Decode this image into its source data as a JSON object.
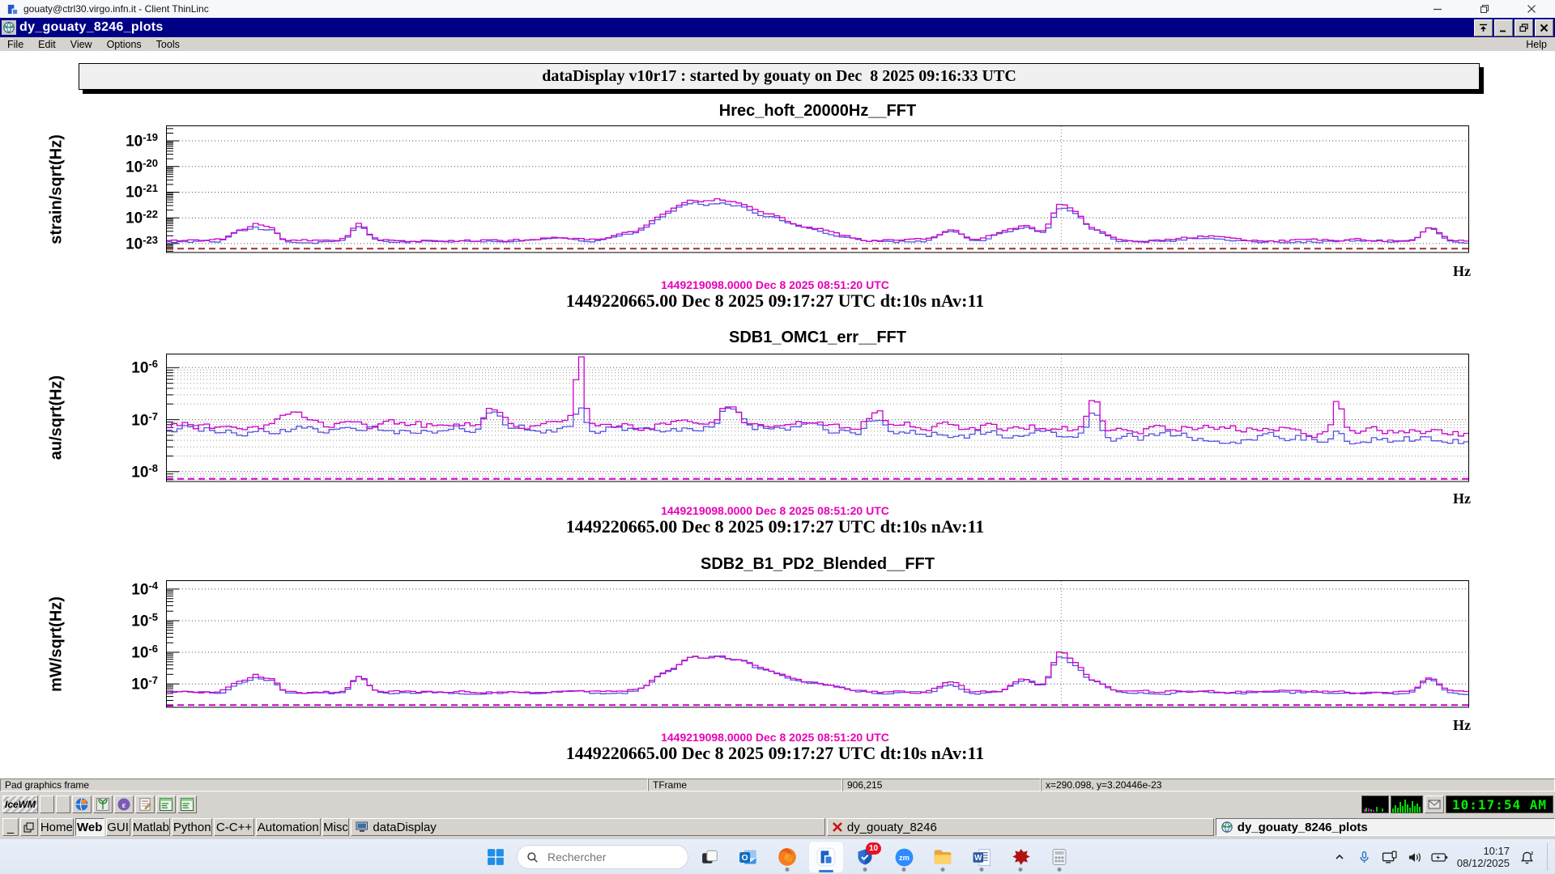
{
  "window": {
    "thinlinc_title": "gouaty@ctrl30.virgo.infn.it - Client ThinLinc",
    "app_title": "dy_gouaty_8246_plots",
    "menu_items": [
      "File",
      "Edit",
      "View",
      "Options",
      "Tools"
    ],
    "menu_help": "Help",
    "banner": "dataDisplay v10r17 : started by gouaty on Dec  8 2025 09:16:33 UTC"
  },
  "footer": {
    "gps_line": "1449219098.0000 Dec 8 2025 08:51:20 UTC",
    "utc_line": "1449220665.00 Dec 8 2025 09:17:27 UTC dt:10s nAv:11"
  },
  "chart_data": [
    {
      "type": "line",
      "title": "Hrec_hoft_20000Hz__FFT",
      "ylabel": "strain/sqrt(Hz)",
      "xlabel": "Hz",
      "yticks_exp": [
        -19,
        -20,
        -21,
        -22,
        -23
      ],
      "ylog_range": [
        -23.35,
        -18.4
      ],
      "minor_grid": false,
      "x_gridline_frac": 0.687,
      "ref_line": {
        "log": -23.2,
        "color": "#993333"
      },
      "series": [
        {
          "name": "blue spectrum",
          "color": "#5555e0",
          "seed": 77,
          "baseline": -22.92,
          "noise": 0.06,
          "peaks": [
            [
              0.054,
              0.38,
              0.006
            ],
            [
              0.067,
              0.55,
              0.005
            ],
            [
              0.079,
              0.46,
              0.005
            ],
            [
              0.147,
              0.6,
              0.006
            ],
            [
              0.3,
              0.14,
              0.012
            ],
            [
              0.355,
              0.28,
              0.015
            ],
            [
              0.385,
              0.92,
              0.012
            ],
            [
              0.404,
              1.1,
              0.009
            ],
            [
              0.422,
              1.16,
              0.009
            ],
            [
              0.44,
              1.0,
              0.01
            ],
            [
              0.462,
              0.8,
              0.014
            ],
            [
              0.495,
              0.42,
              0.02
            ],
            [
              0.603,
              0.4,
              0.008
            ],
            [
              0.641,
              0.25,
              0.008
            ],
            [
              0.66,
              0.5,
              0.009
            ],
            [
              0.687,
              1.22,
              0.0065
            ],
            [
              0.7,
              0.78,
              0.006
            ],
            [
              0.715,
              0.4,
              0.008
            ],
            [
              0.8,
              0.16,
              0.012
            ],
            [
              0.972,
              0.5,
              0.006
            ]
          ]
        },
        {
          "name": "magenta spectrum",
          "color": "#cc00cc",
          "seed": 913,
          "baseline": -22.88,
          "noise": 0.06,
          "peaks": [
            [
              0.054,
              0.4,
              0.006
            ],
            [
              0.067,
              0.58,
              0.005
            ],
            [
              0.079,
              0.48,
              0.005
            ],
            [
              0.147,
              0.62,
              0.006
            ],
            [
              0.3,
              0.15,
              0.012
            ],
            [
              0.355,
              0.3,
              0.015
            ],
            [
              0.385,
              0.95,
              0.012
            ],
            [
              0.404,
              1.15,
              0.009
            ],
            [
              0.422,
              1.22,
              0.009
            ],
            [
              0.44,
              1.05,
              0.01
            ],
            [
              0.462,
              0.85,
              0.014
            ],
            [
              0.495,
              0.45,
              0.02
            ],
            [
              0.603,
              0.42,
              0.008
            ],
            [
              0.641,
              0.26,
              0.008
            ],
            [
              0.66,
              0.52,
              0.009
            ],
            [
              0.687,
              1.35,
              0.0065
            ],
            [
              0.7,
              0.82,
              0.006
            ],
            [
              0.715,
              0.42,
              0.008
            ],
            [
              0.8,
              0.18,
              0.012
            ],
            [
              0.972,
              0.52,
              0.006
            ]
          ]
        }
      ]
    },
    {
      "type": "line",
      "title": "SDB1_OMC1_err__FFT",
      "ylabel": "au/sqrt(Hz)",
      "xlabel": "Hz",
      "yticks_exp": [
        -6,
        -7,
        -8
      ],
      "ylog_range": [
        -8.19,
        -5.73
      ],
      "minor_grid": true,
      "x_gridline_frac": 0.687,
      "ref_line": {
        "log": -8.14,
        "color": "#cc00cc"
      },
      "series": [
        {
          "name": "blue spectrum",
          "color": "#5555e0",
          "seed": 301,
          "baseline": -7.22,
          "noise": 0.1,
          "drift": [
            [
              0,
              0.02
            ],
            [
              0.45,
              0.06
            ],
            [
              0.55,
              0.0
            ],
            [
              0.7,
              -0.1
            ],
            [
              0.85,
              -0.13
            ],
            [
              1,
              -0.18
            ]
          ],
          "peaks": [
            [
              0.249,
              0.38,
              0.006
            ],
            [
              0.317,
              0.4,
              0.004
            ],
            [
              0.432,
              0.42,
              0.007
            ],
            [
              0.546,
              0.22,
              0.006
            ],
            [
              0.713,
              0.46,
              0.0045
            ],
            [
              0.901,
              0.18,
              0.004
            ]
          ]
        },
        {
          "name": "magenta spectrum",
          "color": "#cc00cc",
          "seed": 502,
          "baseline": -7.15,
          "noise": 0.1,
          "drift": [
            [
              0,
              0.02
            ],
            [
              0.5,
              0.03
            ],
            [
              0.75,
              -0.02
            ],
            [
              0.9,
              -0.08
            ],
            [
              1,
              -0.12
            ]
          ],
          "peaks": [
            [
              0.1,
              0.22,
              0.01
            ],
            [
              0.249,
              0.42,
              0.006
            ],
            [
              0.317,
              1.42,
              0.0032
            ],
            [
              0.432,
              0.38,
              0.007
            ],
            [
              0.546,
              0.3,
              0.006
            ],
            [
              0.713,
              0.5,
              0.004
            ],
            [
              0.901,
              0.72,
              0.0035
            ]
          ]
        }
      ]
    },
    {
      "type": "line",
      "title": "SDB2_B1_PD2_Blended__FFT",
      "ylabel": "mW/sqrt(Hz)",
      "xlabel": "Hz",
      "yticks_exp": [
        -4,
        -5,
        -6,
        -7
      ],
      "ylog_range": [
        -7.74,
        -3.72
      ],
      "minor_grid": false,
      "x_gridline_frac": 0.687,
      "ref_line": {
        "log": -7.67,
        "color": "#cc00cc"
      },
      "series": [
        {
          "name": "blue spectrum",
          "color": "#5555e0",
          "seed": 640,
          "baseline": -7.28,
          "noise": 0.05,
          "peaks": [
            [
              0.054,
              0.28,
              0.006
            ],
            [
              0.067,
              0.44,
              0.005
            ],
            [
              0.079,
              0.36,
              0.005
            ],
            [
              0.147,
              0.5,
              0.006
            ],
            [
              0.385,
              0.6,
              0.012
            ],
            [
              0.404,
              0.82,
              0.009
            ],
            [
              0.422,
              0.9,
              0.009
            ],
            [
              0.44,
              0.75,
              0.01
            ],
            [
              0.462,
              0.55,
              0.014
            ],
            [
              0.495,
              0.28,
              0.02
            ],
            [
              0.603,
              0.28,
              0.008
            ],
            [
              0.66,
              0.38,
              0.009
            ],
            [
              0.687,
              1.1,
              0.0065
            ],
            [
              0.7,
              0.6,
              0.006
            ],
            [
              0.715,
              0.3,
              0.008
            ],
            [
              0.972,
              0.42,
              0.006
            ]
          ]
        },
        {
          "name": "magenta spectrum",
          "color": "#cc00cc",
          "seed": 71,
          "baseline": -7.25,
          "noise": 0.05,
          "peaks": [
            [
              0.054,
              0.3,
              0.006
            ],
            [
              0.067,
              0.46,
              0.005
            ],
            [
              0.079,
              0.38,
              0.005
            ],
            [
              0.147,
              0.52,
              0.006
            ],
            [
              0.385,
              0.62,
              0.012
            ],
            [
              0.404,
              0.78,
              0.009
            ],
            [
              0.422,
              0.86,
              0.009
            ],
            [
              0.44,
              0.72,
              0.01
            ],
            [
              0.462,
              0.52,
              0.014
            ],
            [
              0.495,
              0.26,
              0.02
            ],
            [
              0.603,
              0.3,
              0.008
            ],
            [
              0.66,
              0.4,
              0.009
            ],
            [
              0.687,
              1.18,
              0.0065
            ],
            [
              0.7,
              0.62,
              0.006
            ],
            [
              0.715,
              0.32,
              0.008
            ],
            [
              0.972,
              0.45,
              0.006
            ]
          ]
        }
      ]
    }
  ],
  "status_bar": [
    "Pad graphics frame",
    "TFrame",
    "906,215",
    "x=290.098, y=3.20446e-23"
  ],
  "icewm": {
    "logo": "IceWM",
    "launchers": [
      "web-browser-icon",
      "gimp-icon",
      "emacs-icon",
      "text-editor-icon",
      "terminal-icon",
      "terminal-icon"
    ],
    "clock": "10:17:54 AM",
    "tabs": [
      {
        "label": "Home",
        "active": false
      },
      {
        "label": "Web",
        "active": true
      },
      {
        "label": "GUI",
        "active": false
      },
      {
        "label": "Matlab",
        "active": false
      },
      {
        "label": "Python",
        "active": false
      },
      {
        "label": "C-C++",
        "active": false
      },
      {
        "label": "Automation",
        "active": false
      },
      {
        "label": "Misc",
        "active": false
      }
    ],
    "tasks": [
      {
        "label": "dataDisplay",
        "icon": "monitor-icon",
        "active": false
      },
      {
        "label": "dy_gouaty_8246",
        "icon": "red-x-icon",
        "active": false
      },
      {
        "label": "dy_gouaty_8246_plots",
        "icon": "globe-refresh-icon",
        "active": true
      }
    ]
  },
  "win_taskbar": {
    "search_placeholder": "Rechercher",
    "apps": [
      {
        "icon": "taskview-icon",
        "running": false,
        "active": false
      },
      {
        "icon": "outlook-icon",
        "running": false,
        "active": false
      },
      {
        "icon": "firefox-icon",
        "running": true,
        "active": false
      },
      {
        "icon": "thinlinc-icon",
        "running": true,
        "active": true
      },
      {
        "icon": "defender-icon",
        "running": true,
        "active": false,
        "badge": "10"
      },
      {
        "icon": "zoom-icon",
        "running": true,
        "active": false
      },
      {
        "icon": "files-icon",
        "running": true,
        "active": false
      },
      {
        "icon": "word-icon",
        "running": true,
        "active": false
      },
      {
        "icon": "keepass-icon",
        "running": true,
        "active": false
      },
      {
        "icon": "calculator-icon",
        "running": true,
        "active": false
      }
    ],
    "tray_icons": [
      "chevron-up-icon",
      "microphone-icon",
      "display-icon",
      "speaker-icon",
      "battery-icon"
    ],
    "clock_time": "10:17",
    "clock_date": "08/12/2025"
  },
  "colors": {
    "titlebar_blue": "#000087",
    "curve_blue": "#5555e0",
    "curve_magenta": "#cc00cc",
    "timestamp_magenta": "#e800b8",
    "lcd_green": "#00ee00"
  }
}
